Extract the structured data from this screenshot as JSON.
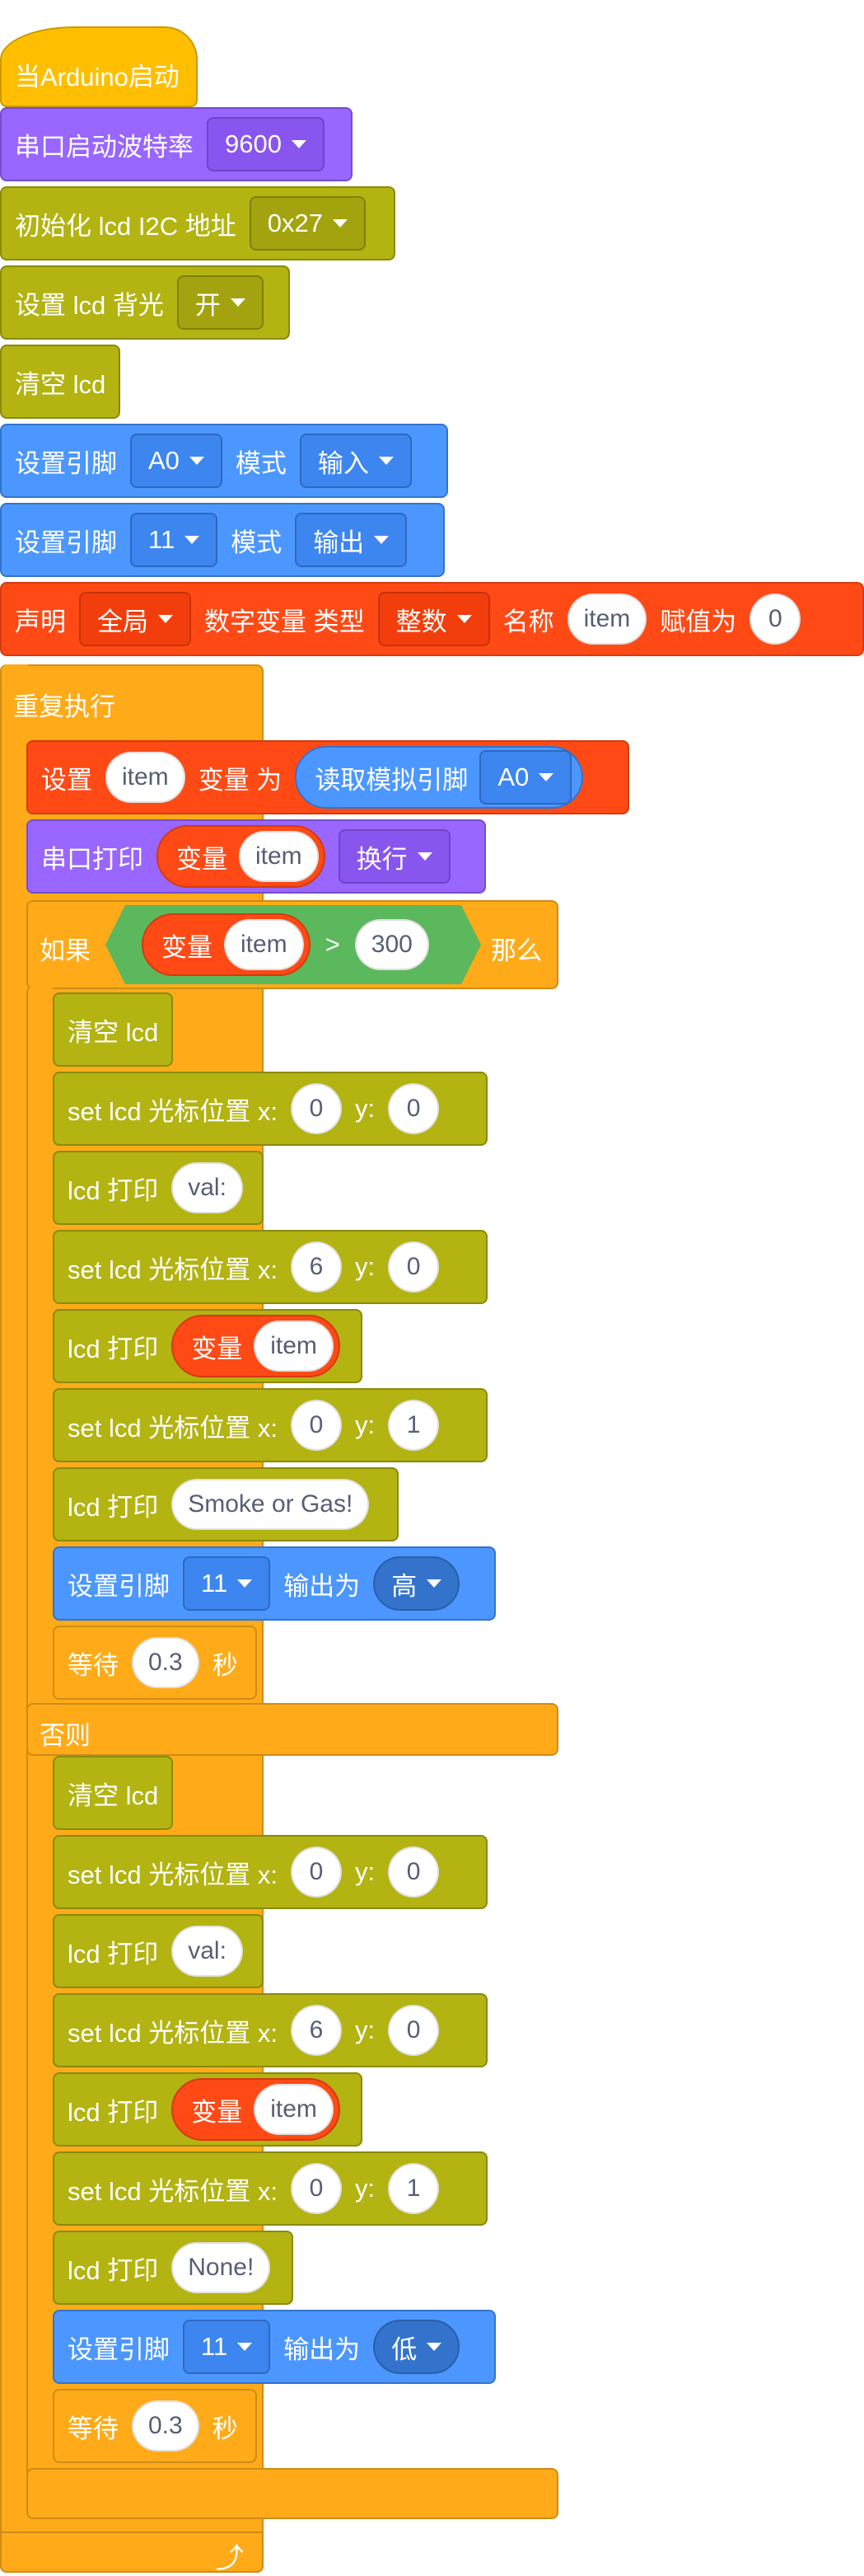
{
  "setup": {
    "when_start": "当Arduino启动",
    "serial_baud_label": "串口启动波特率",
    "serial_baud_value": "9600",
    "lcd_init_label": "初始化 lcd I2C 地址",
    "lcd_init_addr": "0x27",
    "lcd_backlight_label": "设置 lcd 背光",
    "lcd_backlight_value": "开",
    "lcd_clear": "清空 lcd",
    "pin_mode_a0": {
      "label": "设置引脚",
      "pin": "A0",
      "mode_label": "模式",
      "mode": "输入"
    },
    "pin_mode_11": {
      "label": "设置引脚",
      "pin": "11",
      "mode_label": "模式",
      "mode": "输出"
    },
    "declare": {
      "label": "声明",
      "scope": "全局",
      "type_label": "数字变量 类型",
      "type": "整数",
      "name_label": "名称",
      "name": "item",
      "assign_label": "赋值为",
      "value": "0"
    }
  },
  "loop": {
    "label": "重复执行",
    "set_var": {
      "label": "设置",
      "var": "item",
      "mid": "变量 为",
      "reporter": "读取模拟引脚",
      "pin": "A0"
    },
    "serial_print": {
      "label": "串口打印",
      "var_label": "变量",
      "var": "item",
      "newline": "换行"
    },
    "if": {
      "label": "如果",
      "var_label": "变量",
      "var": "item",
      "op": ">",
      "value": "300",
      "then": "那么"
    },
    "then_branch": {
      "clear": "清空 lcd",
      "cursor1": {
        "label": "set lcd 光标位置 x:",
        "x": "0",
        "ylabel": "y:",
        "y": "0"
      },
      "print1": {
        "label": "lcd 打印",
        "text": "val:"
      },
      "cursor2": {
        "label": "set lcd 光标位置 x:",
        "x": "6",
        "ylabel": "y:",
        "y": "0"
      },
      "print2": {
        "label": "lcd 打印",
        "var_label": "变量",
        "var": "item"
      },
      "cursor3": {
        "label": "set lcd 光标位置 x:",
        "x": "0",
        "ylabel": "y:",
        "y": "1"
      },
      "print3": {
        "label": "lcd 打印",
        "text": "Smoke or Gas!"
      },
      "digital_write": {
        "label": "设置引脚",
        "pin": "11",
        "out_label": "输出为",
        "level": "高"
      },
      "wait": {
        "label": "等待",
        "value": "0.3",
        "unit": "秒"
      }
    },
    "else_label": "否则",
    "else_branch": {
      "clear": "清空 lcd",
      "cursor1": {
        "label": "set lcd 光标位置 x:",
        "x": "0",
        "ylabel": "y:",
        "y": "0"
      },
      "print1": {
        "label": "lcd 打印",
        "text": "val:"
      },
      "cursor2": {
        "label": "set lcd 光标位置 x:",
        "x": "6",
        "ylabel": "y:",
        "y": "0"
      },
      "print2": {
        "label": "lcd 打印",
        "var_label": "变量",
        "var": "item"
      },
      "cursor3": {
        "label": "set lcd 光标位置 x:",
        "x": "0",
        "ylabel": "y:",
        "y": "1"
      },
      "print3": {
        "label": "lcd 打印",
        "text": "None!"
      },
      "digital_write": {
        "label": "设置引脚",
        "pin": "11",
        "out_label": "输出为",
        "level": "低"
      },
      "wait": {
        "label": "等待",
        "value": "0.3",
        "unit": "秒"
      }
    },
    "repeat_icon": "loop-arrow-icon"
  },
  "colors": {
    "event": "#FFBF00",
    "serial": "#9966FF",
    "lcd": "#B3B312",
    "pins": "#4C97FF",
    "variables": "#FF4A16",
    "control": "#FFAB19",
    "operators": "#5CB85C"
  }
}
